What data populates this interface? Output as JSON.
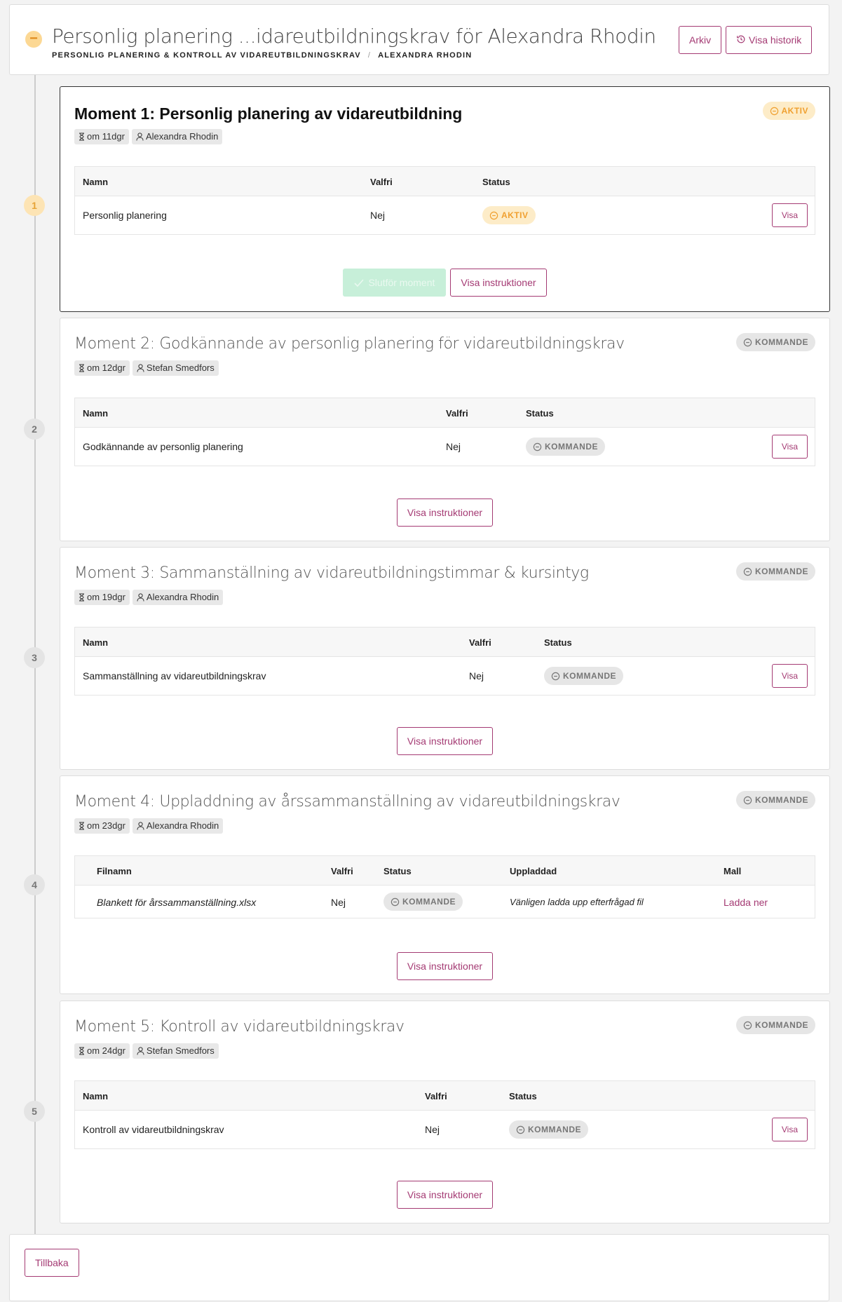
{
  "header": {
    "collapse_symbol": "−",
    "title": "Personlig planering ...idareutbildningskrav för Alexandra Rhodin",
    "breadcrumb": [
      "PERSONLIG PLANERING & KONTROLL AV VIDAREUTBILDNINGSKRAV",
      "ALEXANDRA RHODIN"
    ],
    "archive_label": "Arkiv",
    "history_label": "Visa historik"
  },
  "colors": {
    "accent": "#a43a73",
    "active": "#f0a030",
    "active_bg": "#fdecc8",
    "upcoming": "#777777",
    "success_bg": "#c7efd9"
  },
  "icons": {
    "collapse": "minus-icon",
    "history": "history-icon",
    "hourglass": "hourglass-icon",
    "user": "user-icon",
    "status": "minus-circle-icon",
    "check": "check-icon"
  },
  "moments": [
    {
      "step": "1",
      "title": "Moment 1: Personlig planering av vidareutbildning",
      "status": "AKTIV",
      "due": "om 11dgr",
      "assignee": "Alexandra Rhodin",
      "columns": [
        "Namn",
        "Valfri",
        "Status"
      ],
      "rows": [
        {
          "name": "Personlig planering",
          "optional": "Nej",
          "status": "AKTIV",
          "action": "Visa"
        }
      ],
      "complete_label": "Slutför moment",
      "instructions_label": "Visa instruktioner"
    },
    {
      "step": "2",
      "title": "Moment 2: Godkännande av personlig planering för vidareutbildningskrav",
      "status": "KOMMANDE",
      "due": "om 12dgr",
      "assignee": "Stefan Smedfors",
      "columns": [
        "Namn",
        "Valfri",
        "Status"
      ],
      "rows": [
        {
          "name": "Godkännande av personlig planering",
          "optional": "Nej",
          "status": "KOMMANDE",
          "action": "Visa"
        }
      ],
      "instructions_label": "Visa instruktioner"
    },
    {
      "step": "3",
      "title": "Moment 3: Sammanställning av vidareutbildningstimmar & kursintyg",
      "status": "KOMMANDE",
      "due": "om 19dgr",
      "assignee": "Alexandra Rhodin",
      "columns": [
        "Namn",
        "Valfri",
        "Status"
      ],
      "rows": [
        {
          "name": "Sammanställning av vidareutbildningskrav",
          "optional": "Nej",
          "status": "KOMMANDE",
          "action": "Visa"
        }
      ],
      "instructions_label": "Visa instruktioner"
    },
    {
      "step": "4",
      "title": "Moment 4: Uppladdning av årssammanställning av vidareutbildningskrav",
      "status": "KOMMANDE",
      "due": "om 23dgr",
      "assignee": "Alexandra Rhodin",
      "columns": [
        "Filnamn",
        "Valfri",
        "Status",
        "Uppladdad",
        "Mall"
      ],
      "rows": [
        {
          "name": "Blankett för årssammanställning.xlsx",
          "optional": "Nej",
          "status": "KOMMANDE",
          "uploaded": "Vänligen ladda upp efterfrågad fil",
          "template": "Ladda ner"
        }
      ],
      "instructions_label": "Visa instruktioner"
    },
    {
      "step": "5",
      "title": "Moment 5: Kontroll av vidareutbildningskrav",
      "status": "KOMMANDE",
      "due": "om 24dgr",
      "assignee": "Stefan Smedfors",
      "columns": [
        "Namn",
        "Valfri",
        "Status"
      ],
      "rows": [
        {
          "name": "Kontroll av vidareutbildningskrav",
          "optional": "Nej",
          "status": "KOMMANDE",
          "action": "Visa"
        }
      ],
      "instructions_label": "Visa instruktioner"
    }
  ],
  "footer": {
    "back_label": "Tillbaka"
  }
}
